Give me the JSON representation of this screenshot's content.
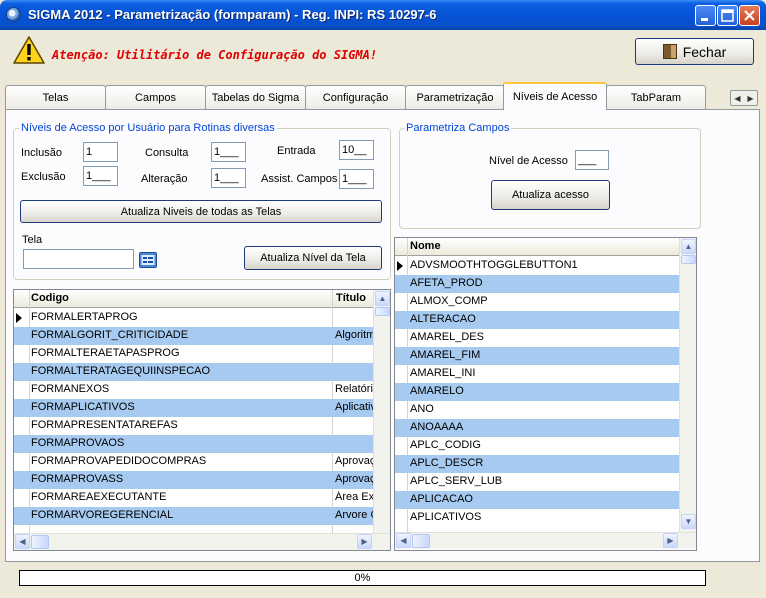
{
  "window": {
    "title": "SIGMA 2012 - Parametrização  (formparam)  - Reg. INPI: RS 10297-6"
  },
  "header": {
    "warning": "Atenção: Utilitário de Configuração do SIGMA!",
    "close_button": "Fechar"
  },
  "tabs": [
    "Telas",
    "Campos",
    "Tabelas do Sigma",
    "Configuração",
    "Parametrização",
    "Níveis de Acesso",
    "TabParam"
  ],
  "active_tab": "Níveis de Acesso",
  "access_levels": {
    "group_title": "Níveis de Acesso por Usuário para Rotinas diversas",
    "inclusao_label": "Inclusão",
    "inclusao_value": "1",
    "consulta_label": "Consulta",
    "consulta_value": "1___",
    "entrada_label": "Entrada",
    "entrada_value": "10__",
    "exclusao_label": "Exclusão",
    "exclusao_value": "1___",
    "alteracao_label": "Alteração",
    "alteracao_value": "1___",
    "assist_label": "Assist. Campos",
    "assist_value": "1___",
    "update_all_button": "Atualiza Niveis de todas as Telas",
    "tela_label": "Tela",
    "tela_value": "",
    "update_screen_button": "Atualiza Nível da Tela"
  },
  "param_fields": {
    "group_title": "Parametriza Campos",
    "nivel_label": "Nível de Acesso",
    "nivel_value": "___",
    "update_button": "Atualiza acesso"
  },
  "forms_grid": {
    "headers": [
      "Codigo",
      "Título"
    ],
    "rows": [
      {
        "code": "FORMALERTAPROG",
        "title": ""
      },
      {
        "code": "FORMALGORIT_CRITICIDADE",
        "title": "Algoritm"
      },
      {
        "code": "FORMALTERAETAPASPROG",
        "title": ""
      },
      {
        "code": "FORMALTERATAGEQUIINSPECAO",
        "title": ""
      },
      {
        "code": "FORMANEXOS",
        "title": "Relatóri"
      },
      {
        "code": "FORMAPLICATIVOS",
        "title": "Aplicativ"
      },
      {
        "code": "FORMAPRESENTATAREFAS",
        "title": ""
      },
      {
        "code": "FORMAPROVAOS",
        "title": ""
      },
      {
        "code": "FORMAPROVAPEDIDOCOMPRAS",
        "title": "Aprovaç"
      },
      {
        "code": "FORMAPROVASS",
        "title": "Aprovaç"
      },
      {
        "code": "FORMAREAEXECUTANTE",
        "title": "Área Ex"
      },
      {
        "code": "FORMARVOREGERENCIAL",
        "title": "Arvore G"
      }
    ]
  },
  "fields_grid": {
    "headers": [
      "Nome"
    ],
    "rows": [
      "ADVSMOOTHTOGGLEBUTTON1",
      "AFETA_PROD",
      "ALMOX_COMP",
      "ALTERACAO",
      "AMAREL_DES",
      "AMAREL_FIM",
      "AMAREL_INI",
      "AMARELO",
      "ANO",
      "ANOAAAA",
      "APLC_CODIG",
      "APLC_DESCR",
      "APLC_SERV_LUB",
      "APLICACAO",
      "APLICATIVOS"
    ]
  },
  "progress": {
    "label": "0%",
    "value": 0
  },
  "colors": {
    "title_bar": "#0753d6",
    "warning_text": "#e00000",
    "group_title": "#0046d5",
    "row_highlight": "#a6caf0",
    "active_tab_accent": "#ffc83c"
  }
}
